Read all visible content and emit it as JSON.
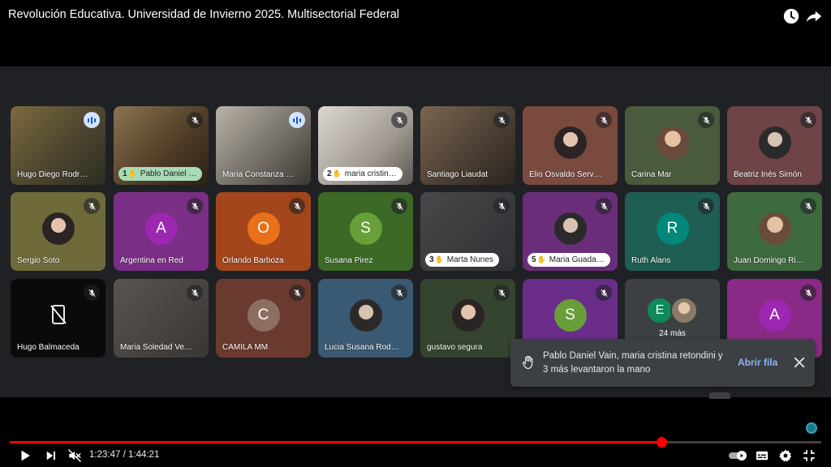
{
  "video": {
    "title": "Revolución Educativa. Universidad de Invierno 2025. Multisectorial Federal",
    "current_time": "1:23:47",
    "time_separator": "/",
    "duration": "1:44:21",
    "progress_fraction": 0.8027,
    "buffered_fraction": 0.805
  },
  "icons": {
    "watch_later": "clock-icon",
    "share": "share-arrow-icon",
    "play": "play-icon",
    "next": "skip-next-icon",
    "mute": "volume-muted-icon",
    "autoplay": "autoplay-toggle-icon",
    "subtitles": "subtitles-icon",
    "settings": "gear-icon",
    "fullscreen": "fullscreen-icon",
    "mic_off": "mic-off-icon",
    "hand": "raised-hand-icon",
    "close": "close-icon"
  },
  "colors": {
    "accent_red": "#ff0000",
    "meet_background": "#202124",
    "toast_background": "#3c4043",
    "link_blue": "#8ab4f8"
  },
  "participants": [
    {
      "name": "Hugo Diego Rodr…",
      "tile": "photo",
      "status": "speaking"
    },
    {
      "name": "Pablo Daniel …",
      "tile": "photo",
      "status": "muted",
      "hand_order": "1"
    },
    {
      "name": "Maria Constanza …",
      "tile": "photo",
      "status": "speaking"
    },
    {
      "name": "maria cristin…",
      "tile": "photo",
      "status": "muted",
      "hand_order": "2"
    },
    {
      "name": "Santiago Liaudat",
      "tile": "photo",
      "status": "muted"
    },
    {
      "name": "Elio Osvaldo Serv…",
      "tile": "avatar-photo",
      "status": "muted"
    },
    {
      "name": "Carina Mar",
      "tile": "avatar-photo",
      "status": "muted"
    },
    {
      "name": "Beatriz Inés Simón",
      "tile": "avatar-photo",
      "status": "muted"
    },
    {
      "name": "Sergio Soto",
      "tile": "avatar-photo",
      "status": "muted"
    },
    {
      "name": "Argentina en Red",
      "tile": "letter",
      "initial": "A",
      "status": "muted"
    },
    {
      "name": "Orlando Barboza",
      "tile": "letter",
      "initial": "O",
      "status": "muted"
    },
    {
      "name": "Susana Pirez",
      "tile": "letter",
      "initial": "S",
      "status": "muted"
    },
    {
      "name": "Marta Nunes",
      "tile": "photo",
      "status": "muted",
      "hand_order": "3"
    },
    {
      "name": "Maria Guada…",
      "tile": "avatar-photo",
      "status": "muted",
      "hand_order": "5"
    },
    {
      "name": "Ruth Alans",
      "tile": "letter",
      "initial": "R",
      "status": "muted"
    },
    {
      "name": "Juan Domingo Ri…",
      "tile": "avatar-photo",
      "status": "muted"
    },
    {
      "name": "Hugo Balmaceda",
      "tile": "camera-off",
      "status": "muted"
    },
    {
      "name": "Maria Soledad Ve…",
      "tile": "photo",
      "status": "muted"
    },
    {
      "name": "CAMILA MM",
      "tile": "letter",
      "initial": "C",
      "status": "muted"
    },
    {
      "name": "Lucia Susana Rod…",
      "tile": "avatar-photo",
      "status": "muted"
    },
    {
      "name": "gustavo segura",
      "tile": "avatar-photo",
      "status": "muted"
    },
    {
      "name": "",
      "tile": "letter",
      "initial": "S",
      "status": "muted"
    },
    {
      "name": "",
      "tile": "more",
      "initial": "E",
      "status": "none"
    },
    {
      "name": "",
      "tile": "letter",
      "initial": "A",
      "status": "muted"
    }
  ],
  "more_tile": {
    "label": "24 más"
  },
  "toast": {
    "message": "Pablo Daniel Vain, maria cristina retondini y 3 más levantaron la mano",
    "action_label": "Abrir fila"
  }
}
